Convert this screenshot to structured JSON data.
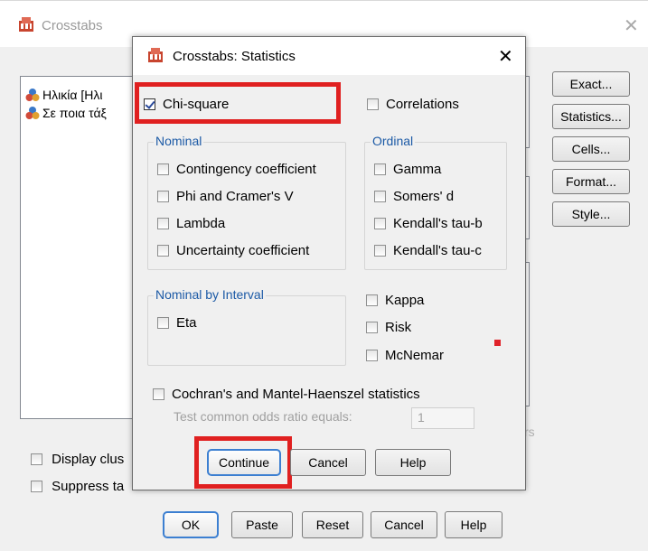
{
  "background_window": {
    "title": "Crosstabs",
    "variables": [
      "Ηλικία [Ηλι",
      "Σε ποια τάξ"
    ],
    "buttons": [
      "Exact...",
      "Statistics...",
      "Cells...",
      "Format...",
      "Style..."
    ],
    "bottom_checkboxes": [
      {
        "label": "Display clus",
        "checked": false
      },
      {
        "label": "Suppress ta",
        "checked": false
      }
    ],
    "bottom_buttons": [
      "OK",
      "Paste",
      "Reset",
      "Cancel",
      "Help"
    ],
    "partial_text": "rs"
  },
  "dialog": {
    "title": "Crosstabs: Statistics",
    "chi_square": {
      "label": "Chi-square",
      "checked": true
    },
    "correlations": {
      "label": "Correlations",
      "checked": false
    },
    "nominal": {
      "title": "Nominal",
      "options": [
        "Contingency coefficient",
        "Phi and Cramer's V",
        "Lambda",
        "Uncertainty coefficient"
      ]
    },
    "ordinal": {
      "title": "Ordinal",
      "options": [
        "Gamma",
        "Somers' d",
        "Kendall's tau-b",
        "Kendall's tau-c"
      ]
    },
    "nominal_by_interval": {
      "title": "Nominal by Interval",
      "options": [
        "Eta"
      ]
    },
    "other_options": [
      "Kappa",
      "Risk",
      "McNemar"
    ],
    "cochran": {
      "label": "Cochran's and Mantel-Haenszel statistics",
      "checked": false
    },
    "test_common_odds": {
      "label": "Test common odds ratio equals:",
      "value": "1"
    },
    "buttons": {
      "continue": "Continue",
      "cancel": "Cancel",
      "help": "Help"
    }
  },
  "colors": {
    "highlight": "#e02020",
    "group_label": "#1c5aa6",
    "focus_border": "#3c7fd1"
  }
}
